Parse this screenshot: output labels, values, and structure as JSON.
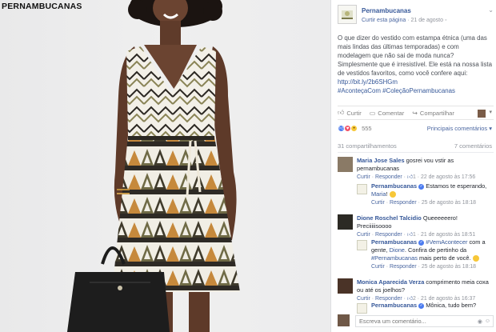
{
  "photo": {
    "brand": "PERNAMBUCANAS"
  },
  "post": {
    "page_name": "Pernambucanas",
    "like_page": "Curtir esta página",
    "separator": " · ",
    "date": "21 de agosto",
    "text": "O que dizer do vestido com estampa étnica (uma das mais lindas das últimas temporadas) e com modelagem que não sai de moda nunca? Simplesmente que é irresistível. Ele está na nossa lista de vestidos favoritos, como você confere aqui:",
    "link": "http://bit.ly/2b6SHGm",
    "hashtags": "#AconteçaCom #ColeçãoPernambucanas"
  },
  "actions": {
    "like": "Curtir",
    "comment": "Comentar",
    "share": "Compartilhar"
  },
  "reactions": {
    "count": "555",
    "sort_label": "Principais comentários"
  },
  "stats": {
    "shares": "31 compartilhamentos",
    "comments": "7 comentários"
  },
  "comments": [
    {
      "name": "Maria Jose Sales",
      "text": " gosrei vou vstir as pernambucanas",
      "like": "Curtir",
      "reply": "Responder",
      "likes": "1",
      "date": "22 de agosto às 17:56",
      "reply_item": {
        "name": "Pernambucanas",
        "text": " Estamos te esperando, ",
        "tag": "Maria",
        "end": "!",
        "like": "Curtir",
        "reply": "Responder",
        "date": "25 de agosto às 18:18"
      }
    },
    {
      "name": "Dione Roschel Talcidio",
      "text": " Queeeeeero! Preciiiiisoooo",
      "like": "Curtir",
      "reply": "Responder",
      "likes": "1",
      "date": "21 de agosto às 18:51",
      "reply_item": {
        "name": "Pernambucanas",
        "tag1": "#VemAcontecer",
        "text1": " com a gente, ",
        "tag2": "Dione",
        "text2": ". Confira de pertinho da ",
        "tag3": "#Pernambucanas",
        "text3": " mais perto de você. ",
        "like": "Curtir",
        "reply": "Responder",
        "date": "25 de agosto às 18:18"
      }
    },
    {
      "name": "Monica Aparecida Verza",
      "text": " comprimento meia coxa ou até os joelhos?",
      "like": "Curtir",
      "reply": "Responder",
      "likes": "2",
      "date": "21 de agosto às 16:37",
      "reply_item": {
        "name": "Pernambucanas",
        "text": " Mônica, tudo bem?"
      }
    }
  ],
  "write": {
    "placeholder": "Escreva um comentário..."
  },
  "colors": {
    "link_blue": "#365899",
    "like_blue": "#4c7cf0",
    "love_red": "#f25268",
    "wow_yellow": "#f7c738"
  }
}
